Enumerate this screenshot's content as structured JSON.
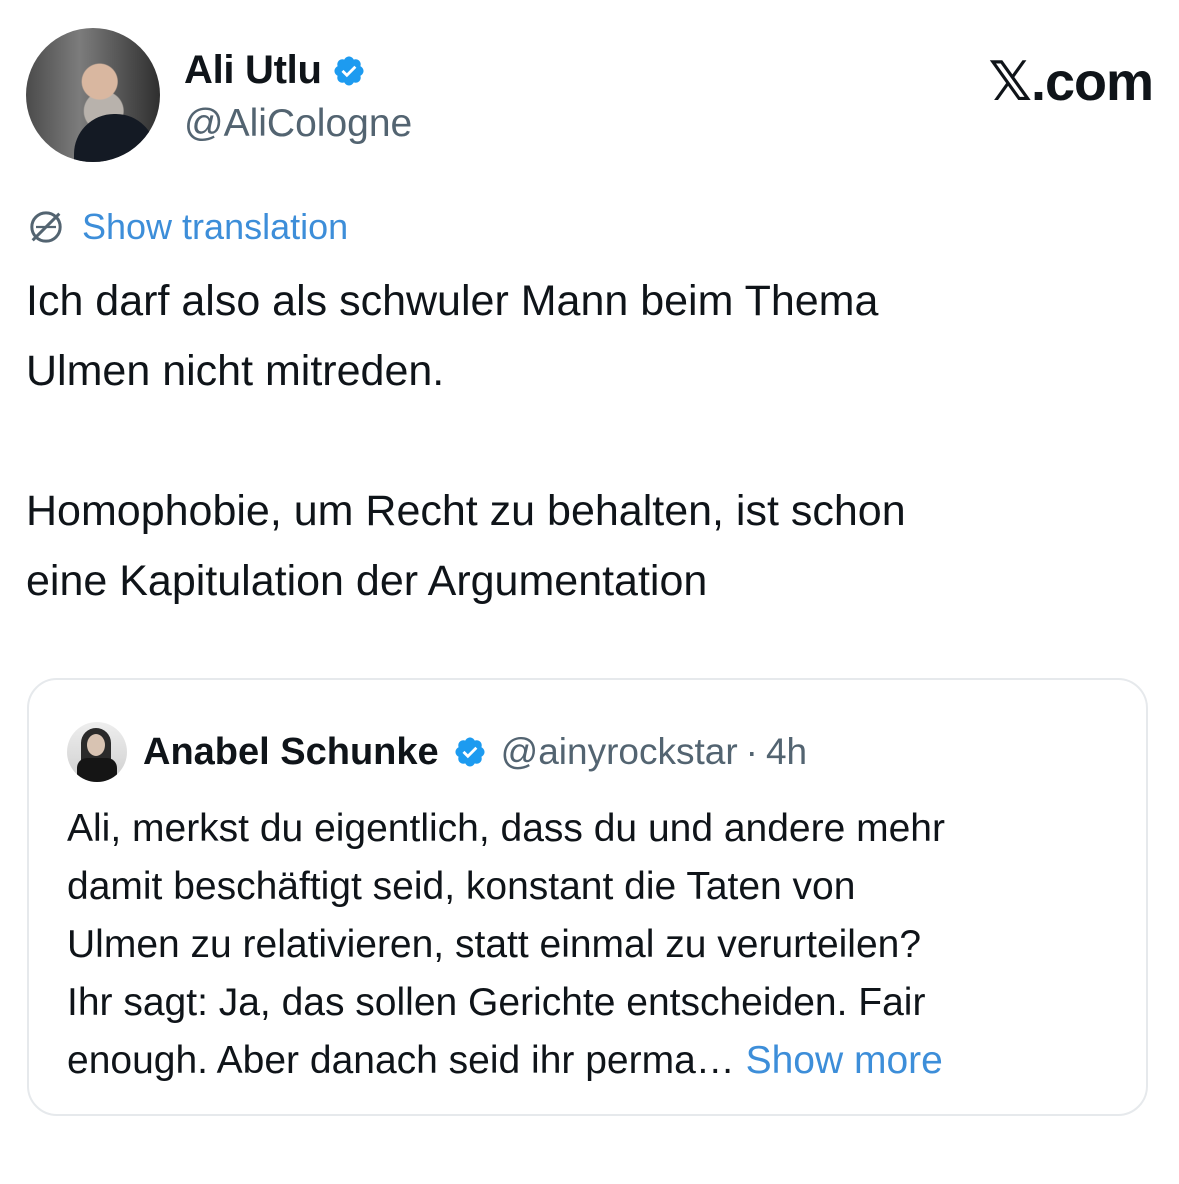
{
  "header": {
    "author_name": "Ali Utlu",
    "author_handle": "@AliCologne",
    "brand": "𝕏.com"
  },
  "translate": {
    "icon": "globe-icon",
    "label": "Show translation"
  },
  "tweet": {
    "paragraph_1_line_1": "Ich darf also als schwuler Mann beim Thema",
    "paragraph_1_line_2": "Ulmen nicht mitreden.",
    "paragraph_2_line_1": "Homophobie, um Recht zu behalten, ist schon",
    "paragraph_2_line_2": "eine Kapitulation der Argumentation"
  },
  "quote": {
    "author_name": "Anabel Schunke",
    "author_handle": "@ainyrockstar",
    "separator": "·",
    "time": "4h",
    "lines": [
      "Ali, merkst du eigentlich, dass du und andere mehr",
      "damit beschäftigt seid, konstant die Taten von",
      "Ulmen zu relativieren, statt einmal zu verurteilen?",
      "Ihr sagt: Ja, das sollen Gerichte entscheiden. Fair",
      "enough. Aber danach seid ihr perma… "
    ],
    "show_more": "Show more"
  },
  "colors": {
    "text": "#0f1419",
    "secondary": "#536471",
    "link": "#3d8ed9",
    "verified": "#1d9bf0",
    "border": "#e6e9ec"
  }
}
